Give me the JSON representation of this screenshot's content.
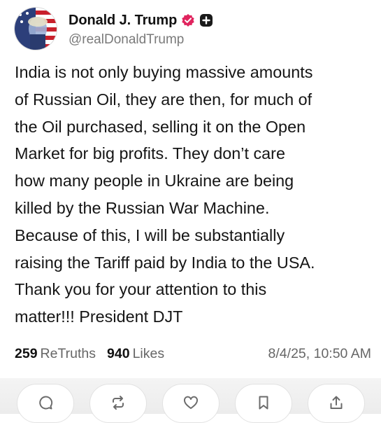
{
  "post": {
    "display_name": "Donald J. Trump",
    "handle": "@realDonaldTrump",
    "body": "India is not only buying massive amounts\nof Russian Oil, they are then, for much of\nthe Oil purchased, selling it on the Open\nMarket for big profits. They don’t care\nhow many people in Ukraine are being\nkilled by the Russian War Machine.\nBecause of this, I will be substantially\nraising the Tariff paid by India to the USA.\nThank you for your attention to this\nmatter!!!     President DJT",
    "retruths_count": "259",
    "retruths_label": "ReTruths",
    "likes_count": "940",
    "likes_label": "Likes",
    "timestamp": "8/4/25, 10:50 AM"
  },
  "icons": {
    "verified": "verified-badge-icon",
    "plus": "plus-icon",
    "reply": "reply-icon",
    "retruth": "retruth-icon",
    "like": "heart-icon",
    "bookmark": "bookmark-icon",
    "share": "share-icon"
  },
  "colors": {
    "verified_badge": "#e0245e",
    "text": "#151515",
    "muted": "#666666",
    "handle": "#7a7a7a",
    "icon": "#6b6b6b"
  }
}
